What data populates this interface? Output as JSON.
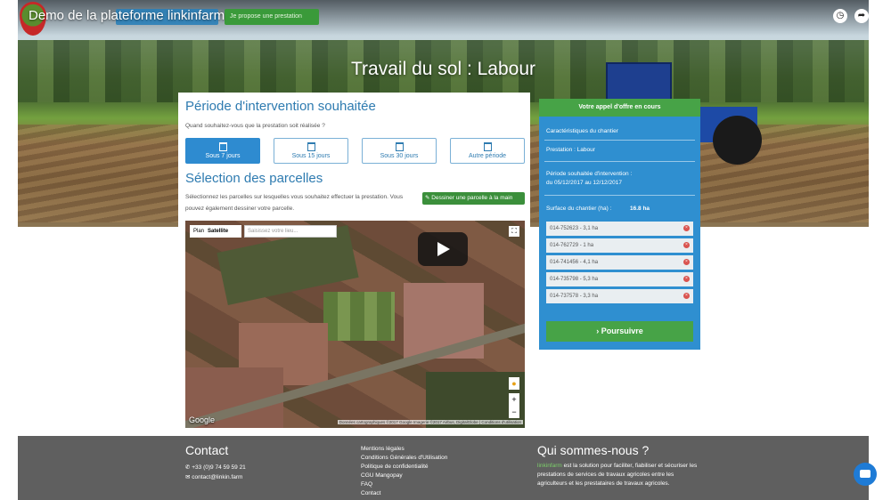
{
  "video": {
    "title": "Demo de la plateforme linkinfarm"
  },
  "top_nav": {
    "green_button": "Je propose une prestation"
  },
  "hero": {
    "title": "Travail du sol : Labour"
  },
  "period": {
    "title": "Période d'intervention souhaitée",
    "question": "Quand souhaitez-vous que la prestation soit réalisée ?",
    "buttons": [
      "Sous 7 jours",
      "Sous 15 jours",
      "Sous 30 jours",
      "Autre période"
    ],
    "active_index": 0
  },
  "parcels": {
    "title": "Sélection des parcelles",
    "instructions_line1": "Sélectionnez les parcelles sur lesquelles vous souhaitez effectuer la prestation. Vous",
    "instructions_line2": "pouvez également dessiner votre parcelle.",
    "draw_button": "Dessiner une parcelle à la main"
  },
  "map": {
    "type_plan": "Plan",
    "type_satellite": "Satellite",
    "search_placeholder": "Saisissez votre lieu...",
    "google_label": "Google",
    "attribution": "Données cartographiques ©2017 Google Imagerie ©2017 Airbus, DigitalGlobe | Conditions d'utilisation"
  },
  "offer": {
    "header": "Votre appel d'offre en cours",
    "characteristics": "Caractéristiques du chantier",
    "prestation": "Prestation : Labour",
    "period_label": "Période souhaitée d'intervention :",
    "period_value": "du 05/12/2017 au 12/12/2017",
    "surface_label": "Surface du chantier (ha) :",
    "surface_value": "16.8 ha",
    "parcels": [
      "014-752623 - 3,1 ha",
      "014-762729 - 1 ha",
      "014-741456 - 4,1 ha",
      "014-735798 - 5,3 ha",
      "014-737578 - 3,3 ha"
    ],
    "continue_button": "Poursuivre"
  },
  "footer": {
    "contact_title": "Contact",
    "phone": "+33 (0)9 74 59 59 21",
    "email": "contact@linkin.farm",
    "links": [
      "Mentions légales",
      "Conditions Générales d'Utilisation",
      "Politique de confidentialité",
      "CGU Mangopay",
      "FAQ",
      "Contact"
    ],
    "about_title": "Qui sommes-nous ?",
    "about_brand": "linkinfarm",
    "about_text": "est la solution pour faciliter, fiabiliser et sécuriser les prestations de services de travaux agricoles entre les agriculteurs et les prestataires de travaux agricoles."
  },
  "colors": {
    "accent_blue": "#2f8fd0",
    "accent_green": "#47a347",
    "footer_bg": "#5f5f5f"
  }
}
